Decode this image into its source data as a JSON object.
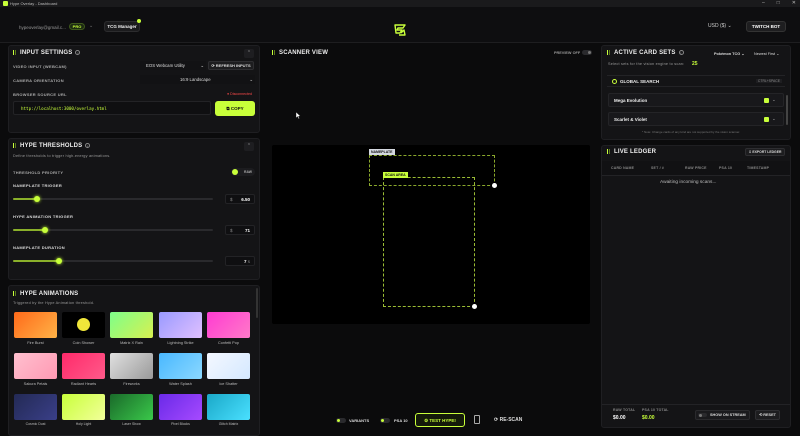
{
  "window": {
    "title": "Hype Overlay - Dashboard",
    "controls": [
      "–",
      "□",
      "✕"
    ]
  },
  "header": {
    "email": "hypeoverlay@gmail.c...",
    "plan_badge": "PRO",
    "manager_tab": "TCG Manager",
    "currency": "USD ($)",
    "twitch_button": "TWITCH BOT"
  },
  "input_settings": {
    "title": "INPUT SETTINGS",
    "video_input_label": "VIDEO INPUT (WEBCAM)",
    "video_input_value": "EOS Webcam Utility",
    "refresh_label": "REFRESH INPUTS",
    "orientation_label": "CAMERA ORIENTATION",
    "orientation_value": "16:9 Landscape",
    "browser_source_label": "BROWSER SOURCE URL",
    "status": "Disconnected",
    "url": "http://localhost:3000/overlay.html",
    "copy_label": "COPY"
  },
  "hype_thresholds": {
    "title": "HYPE THRESHOLDS",
    "description": "Define thresholds to trigger high-energy animations.",
    "priority_label": "THRESHOLD PRIORITY",
    "priority_value": "RAW",
    "nameplate_trigger": {
      "label": "NAMEPLATE TRIGGER",
      "prefix": "$",
      "value": "6.50",
      "fraction": 0.12
    },
    "animation_trigger": {
      "label": "HYPE ANIMATION TRIGGER",
      "prefix": "$",
      "value": "71",
      "fraction": 0.16
    },
    "nameplate_duration": {
      "label": "NAMEPLATE DURATION",
      "value": "7",
      "unit": "s",
      "fraction": 0.23
    }
  },
  "hype_animations": {
    "title": "HYPE ANIMATIONS",
    "description": "Triggered by the Hype Animation threshold.",
    "items": [
      {
        "label": "Fire Burst",
        "color_a": "#ff6a1a",
        "color_b": "#ffb347"
      },
      {
        "label": "Coin Shower",
        "color_a": "#000000",
        "color_b": "#000000"
      },
      {
        "label": "Matrix X Rain",
        "color_a": "#7dff8a",
        "color_b": "#d8f050"
      },
      {
        "label": "Lightning Strike",
        "color_a": "#9a9aff",
        "color_b": "#e0c0ff"
      },
      {
        "label": "Confetti Pop",
        "color_a": "#ff3bd2",
        "color_b": "#ff7ac8"
      },
      {
        "label": "Sakura Petals",
        "color_a": "#ffc0cf",
        "color_b": "#ff99b3"
      },
      {
        "label": "Radiant Hearts",
        "color_a": "#ff2a6a",
        "color_b": "#ff5a8a"
      },
      {
        "label": "Fireworks",
        "color_a": "#e0e0e0",
        "color_b": "#9a9a9a"
      },
      {
        "label": "Water Splash",
        "color_a": "#49b8ff",
        "color_b": "#8bd8ff"
      },
      {
        "label": "Ice Shatter",
        "color_a": "#f4f8ff",
        "color_b": "#d4e8ff"
      },
      {
        "label": "Cosmic Dust",
        "color_a": "#232a55",
        "color_b": "#3a3f88"
      },
      {
        "label": "Holy Light",
        "color_a": "#c8ff3a",
        "color_b": "#f2ff9a"
      },
      {
        "label": "Laser Show",
        "color_a": "#1a6a2a",
        "color_b": "#3ac84a"
      },
      {
        "label": "Pixel Blocks",
        "color_a": "#6a2ae8",
        "color_b": "#a64aff"
      },
      {
        "label": "Glitch Matrix",
        "color_a": "#1aa8c8",
        "color_b": "#4ae0ff"
      }
    ]
  },
  "scanner": {
    "title": "SCANNER VIEW",
    "preview_label": "PREVIEW OFF",
    "nameplate_tag": "NAMEPLATE",
    "scan_area_tag": "SCAN AREA"
  },
  "bottom_controls": {
    "variants": "VARIANTS",
    "psa10": "PSA 10",
    "test_hype": "TEST HYPE!",
    "rescan": "RE-SCAN"
  },
  "active_card_sets": {
    "title": "ACTIVE CARD SETS",
    "game_select": "Pokémon TCG",
    "sort_select": "Newest First",
    "description": "Select sets for the vision engine to scan:",
    "count": "25",
    "global_search_label": "GLOBAL SEARCH",
    "shortcut": "CTRL+SPACE",
    "sets": [
      "Mega Evolution",
      "Scarlet & Violet"
    ],
    "footnote": "* Note: Change cards of any kind are not supported by the vision scanner."
  },
  "live_ledger": {
    "title": "LIVE LEDGER",
    "export_label": "EXPORT LEDGER",
    "columns": [
      "CARD NAME",
      "SET / #",
      "RAW PRICE",
      "PSA 10",
      "TIMESTAMP"
    ],
    "empty_message": "Awaiting incoming scans...",
    "raw_total_label": "RAW TOTAL",
    "raw_total_value": "$0.00",
    "psa_total_label": "PSA 10 TOTAL",
    "psa_total_value": "$0.00",
    "show_on_stream": "SHOW ON STREAM",
    "reset": "RESET"
  },
  "accent_color": "#c8ff3a"
}
